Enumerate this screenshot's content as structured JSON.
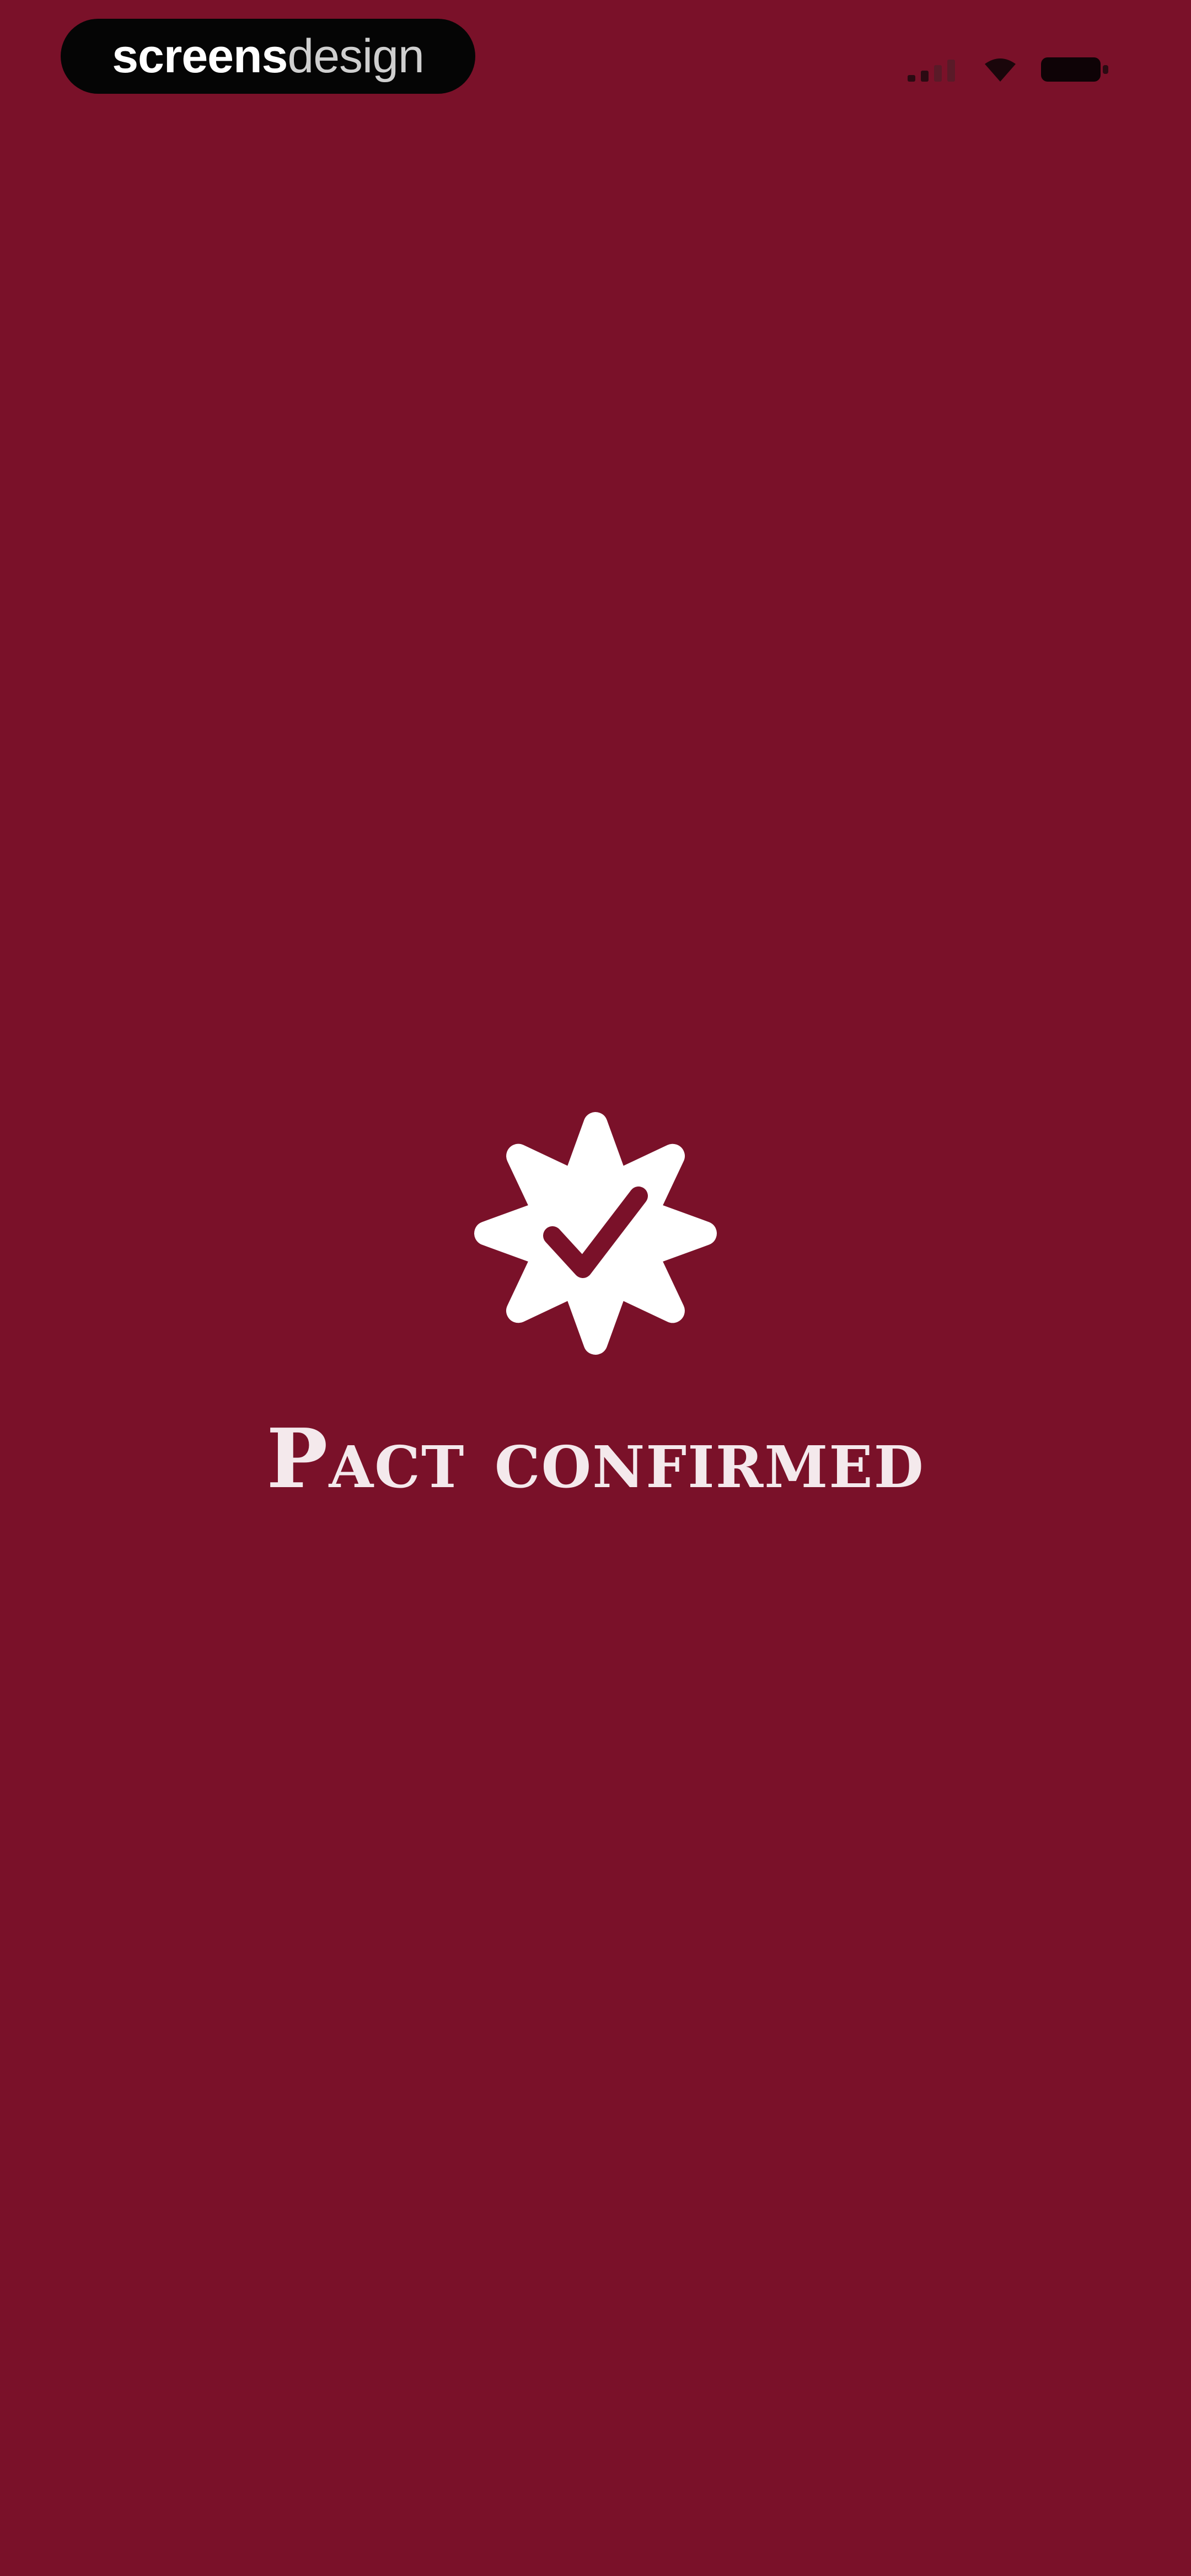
{
  "colors": {
    "background": "#7a1129",
    "foreground": "#ffffff",
    "watermark_pill": "#050505"
  },
  "status_bar": {
    "watermark": {
      "part_bold": "screens",
      "part_light": "design"
    },
    "icons": [
      "cellular-signal-icon",
      "wifi-icon",
      "battery-icon"
    ]
  },
  "main": {
    "badge_icon": "verified-check-badge-icon",
    "title": "Pact confirmed"
  }
}
